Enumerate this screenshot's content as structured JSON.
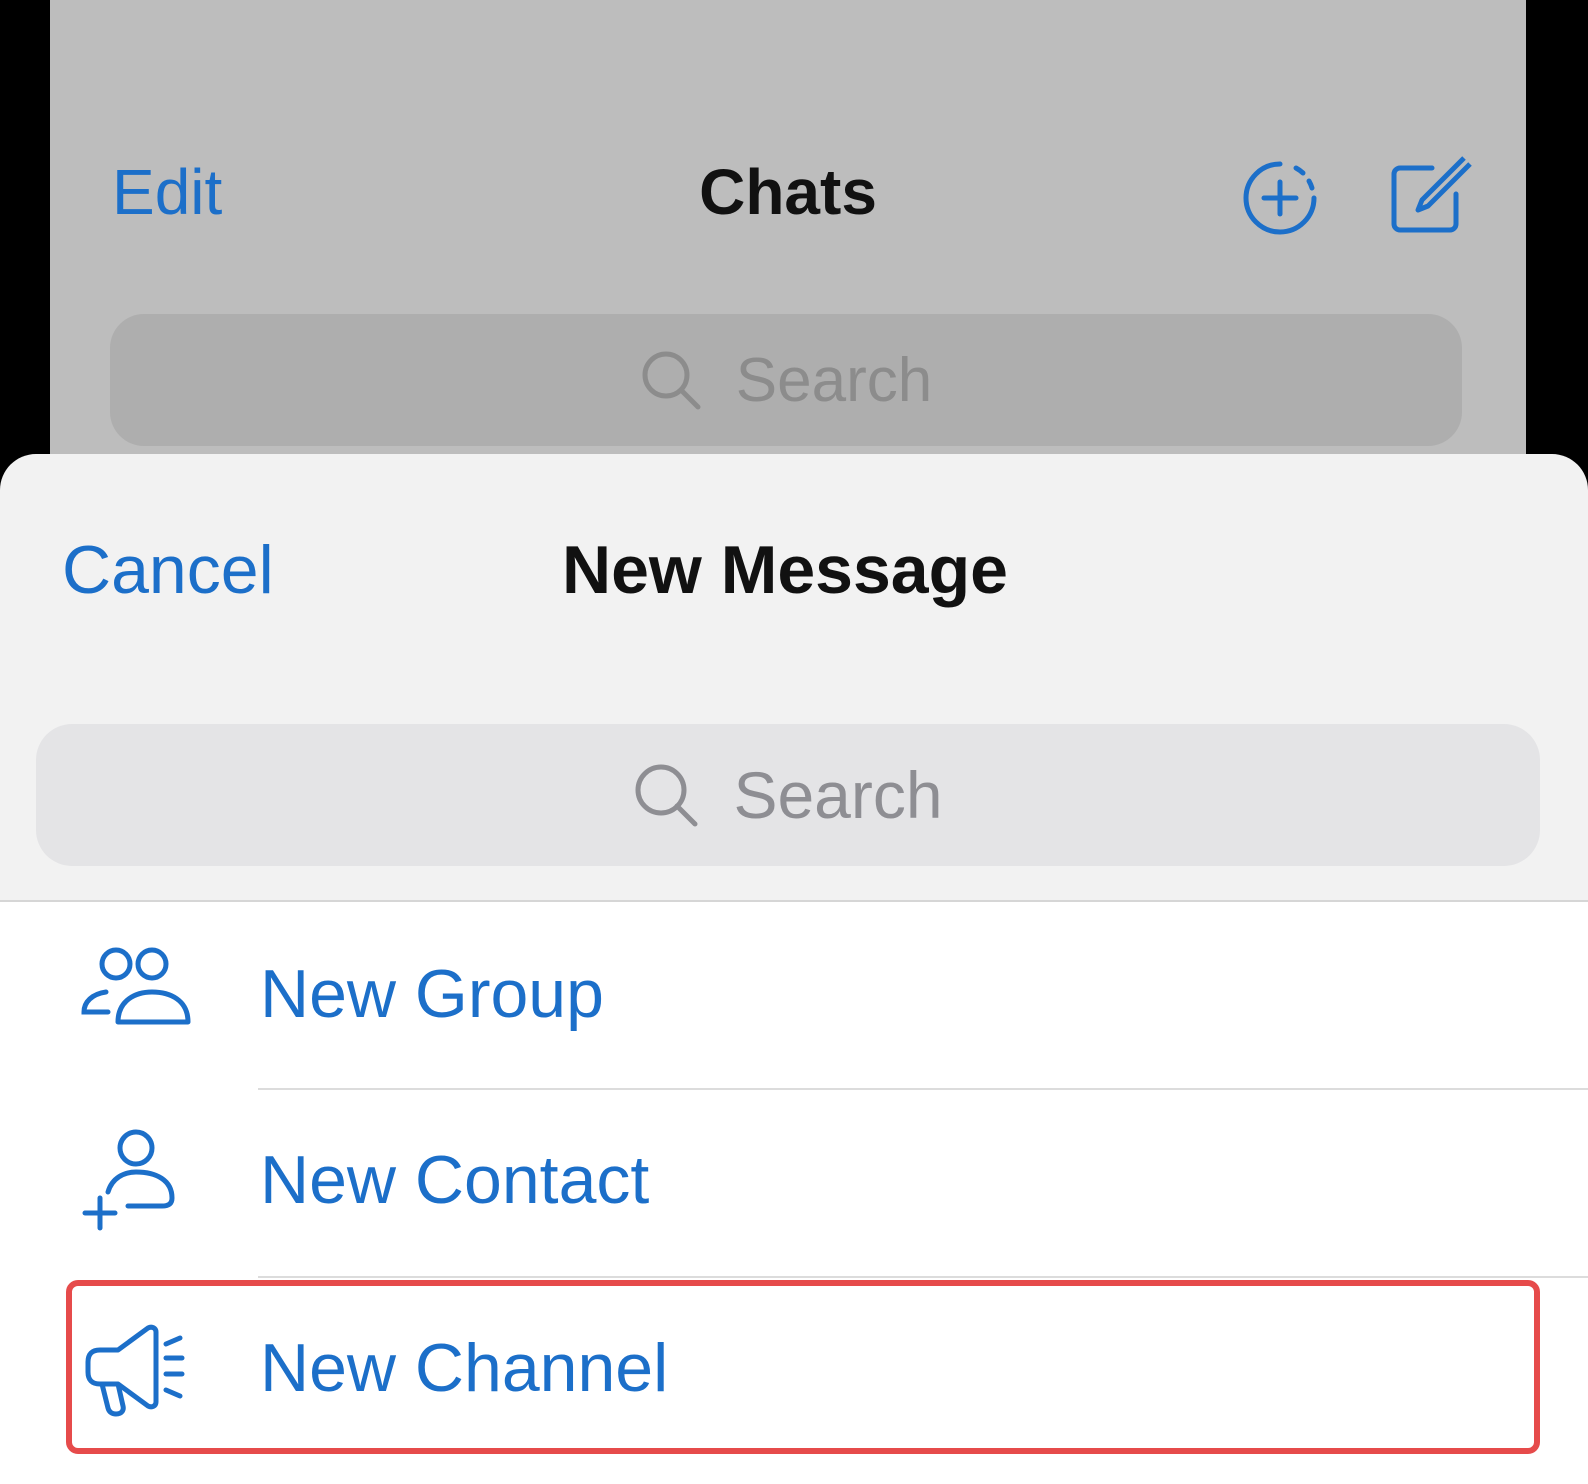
{
  "background": {
    "edit_label": "Edit",
    "title": "Chats",
    "search_placeholder": "Search",
    "icons": [
      "add-story-icon",
      "compose-icon",
      "search-icon"
    ]
  },
  "sheet": {
    "cancel_label": "Cancel",
    "title": "New Message",
    "search_placeholder": "Search",
    "items": [
      {
        "label": "New Group",
        "icon": "group-icon"
      },
      {
        "label": "New Contact",
        "icon": "add-contact-icon"
      },
      {
        "label": "New Channel",
        "icon": "megaphone-icon",
        "highlighted": true
      }
    ]
  },
  "colors": {
    "accent": "#1c6fc9",
    "highlight": "#e64b4b",
    "dimmed_background": "#bdbdbd",
    "sheet_background": "#f2f2f2"
  }
}
